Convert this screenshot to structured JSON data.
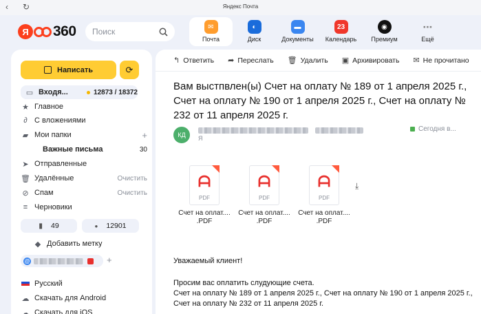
{
  "window": {
    "title": "Яндекс Почта"
  },
  "search": {
    "placeholder": "Поиск"
  },
  "services": [
    {
      "label": "Почта",
      "color": "#ff9d2e",
      "glyph": "✉"
    },
    {
      "label": "Диск",
      "color": "#1a6cdb",
      "glyph": "◐"
    },
    {
      "label": "Документы",
      "color": "#3a86f0",
      "glyph": "▬"
    },
    {
      "label": "Календарь",
      "color": "#f0372b",
      "glyph": "23"
    },
    {
      "label": "Премиум",
      "color": "#111111",
      "glyph": "◉"
    },
    {
      "label": "Ещё",
      "color": "transparent",
      "glyph": "⋯"
    }
  ],
  "sidebar": {
    "write_label": "Написать",
    "inbox": {
      "label": "Входя...",
      "count": "12873 / 18372"
    },
    "folders": [
      {
        "label": "Главное",
        "icon": "star-icon"
      },
      {
        "label": "С вложениями",
        "icon": "paperclip-icon"
      },
      {
        "label": "Мои папки",
        "icon": "folder-icon",
        "right": "+"
      },
      {
        "label": "Важные письма",
        "icon": "",
        "right": "30"
      },
      {
        "label": "Отправленные",
        "icon": "send-icon"
      },
      {
        "label": "Удалённые",
        "icon": "trash-icon",
        "right": "Очистить"
      },
      {
        "label": "Спам",
        "icon": "spam-icon",
        "right": "Очистить"
      },
      {
        "label": "Черновики",
        "icon": "draft-icon"
      }
    ],
    "flagged_count": "49",
    "unread_count": "12901",
    "add_label": "Добавить метку",
    "bottom": [
      {
        "label": "Русский",
        "icon": "flag-icon"
      },
      {
        "label": "Скачать для Android",
        "icon": "android-icon"
      },
      {
        "label": "Скачать для iOS",
        "icon": "apple-icon"
      }
    ]
  },
  "toolbar": {
    "reply": "Ответить",
    "forward": "Переслать",
    "delete": "Удалить",
    "archive": "Архивировать",
    "unread": "Не прочитано"
  },
  "message": {
    "subject": "Вам выстпвлен(ы) Счет на оплату № 189 от 1 апреля 2025 г., Счет на оплату № 190 от 1 апреля 2025 г., Счет на оплату № 232 от 11 апреля 2025 г.",
    "avatar_initials": "КД",
    "date": "Сегодня в...",
    "to": "Я",
    "attachments": [
      {
        "name": "Счет на оплат.... .PDF",
        "type": "PDF"
      },
      {
        "name": "Счет на оплат.... .PDF",
        "type": "PDF"
      },
      {
        "name": "Счет на оплат.... .PDF",
        "type": "PDF"
      }
    ],
    "greeting": "Уважаемый клиент!",
    "body_line1": "Просим вас оплатить слудующие счета.",
    "body_line2": "Счет на оплату № 189 от 1 апреля 2025 г., Счет на оплату № 190 от 1 апреля 2025 г., Счет на оплату № 232 от 11 апреля 2025 г."
  }
}
